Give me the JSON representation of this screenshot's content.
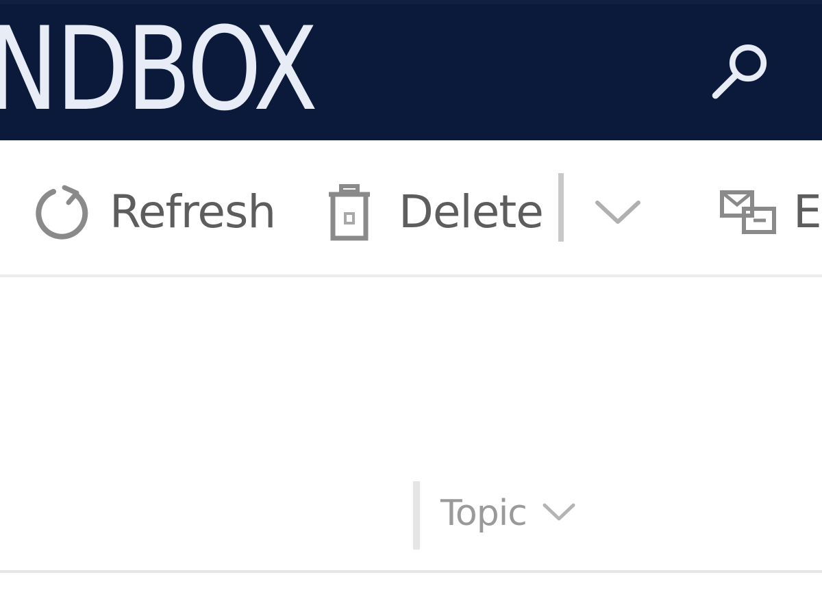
{
  "header": {
    "title": "NDBOX",
    "search_icon": "search-icon",
    "background_color": "#0b1a3a"
  },
  "commandbar": {
    "refresh_label": "Refresh",
    "refresh_icon": "refresh-icon",
    "delete_label": "Delete",
    "delete_icon": "trash-icon",
    "more_icon": "chevron-down-icon",
    "email_label": "E",
    "email_icon": "email-link-icon"
  },
  "grid": {
    "columns": [
      {
        "label": "Topic",
        "sort_icon": "chevron-down-icon"
      }
    ]
  }
}
